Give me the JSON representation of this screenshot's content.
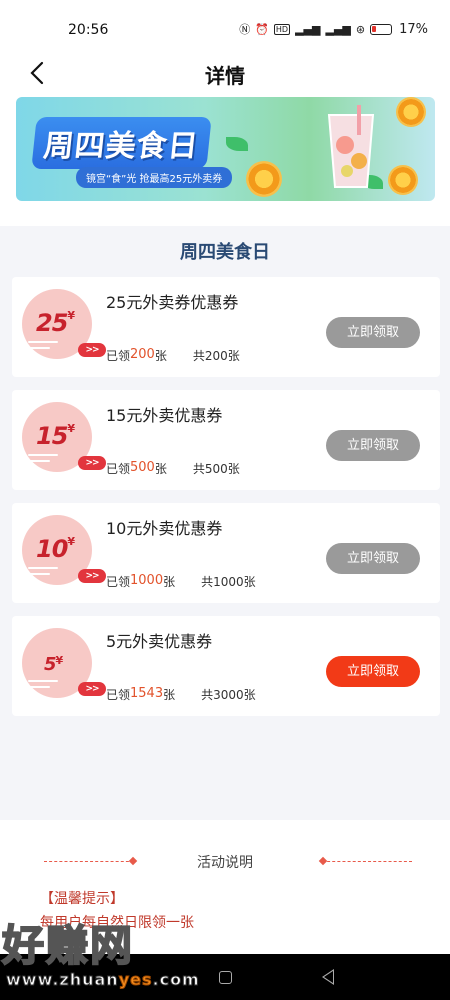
{
  "status_bar": {
    "time": "20:56",
    "battery": "17%",
    "icons": [
      "nfc-icon",
      "alarm-icon",
      "hd-icon",
      "signal-icon",
      "signal-5g-icon",
      "security-icon",
      "battery-icon"
    ]
  },
  "nav": {
    "title": "详情",
    "back_icon": "chevron-left-icon"
  },
  "banner": {
    "title": "周四美食日",
    "subtitle": "镜宫“食”光 抢最高25元外卖券"
  },
  "section_title": "周四美食日",
  "coupons": [
    {
      "amount": "25",
      "yen": "¥",
      "title": "25元外卖券优惠券",
      "claimed_label": "已领",
      "claimed": "200",
      "unit": "张",
      "total": "共200张",
      "button": "立即领取",
      "enabled": false
    },
    {
      "amount": "15",
      "yen": "¥",
      "title": "15元外卖优惠券",
      "claimed_label": "已领",
      "claimed": "500",
      "unit": "张",
      "total": "共500张",
      "button": "立即领取",
      "enabled": false
    },
    {
      "amount": "10",
      "yen": "¥",
      "title": "10元外卖优惠券",
      "claimed_label": "已领",
      "claimed": "1000",
      "unit": "张",
      "total": "共1000张",
      "button": "立即领取",
      "enabled": false
    },
    {
      "amount": "5",
      "yen": "¥",
      "title": "5元外卖优惠券",
      "claimed_label": "已领",
      "claimed": "1543",
      "unit": "张",
      "total": "共3000张",
      "button": "立即领取",
      "enabled": true
    }
  ],
  "badge_arrow": ">>",
  "explain": {
    "header": "活动说明",
    "tip_title": "【温馨提示】",
    "tip_text": "每用户每自然日限领一张"
  },
  "watermark": {
    "big": "好赚网",
    "small_a": "www.zhuan",
    "small_b": "yes",
    "small_c": ".com"
  },
  "colors": {
    "accent": "#f23a17",
    "disabled": "#9a9a9a",
    "section_title": "#2a4a74",
    "claimed_num": "#e2532c"
  }
}
